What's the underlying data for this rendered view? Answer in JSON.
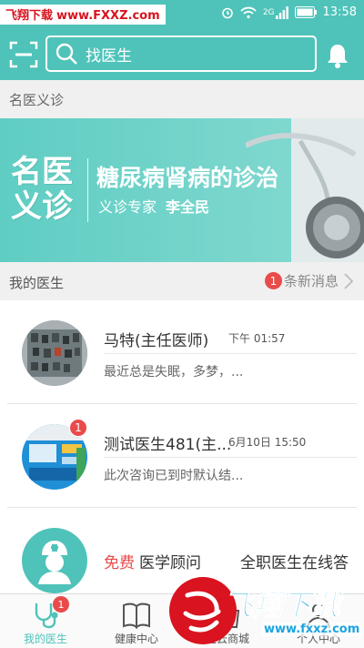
{
  "status_bar": {
    "watermark_left": "飞翔下载",
    "watermark_url": "www.FXXZ.com",
    "network": "2G",
    "time": "13:58"
  },
  "header": {
    "search_placeholder": "找医生",
    "icons": [
      "scan-icon",
      "search-icon",
      "bell-icon"
    ],
    "bg_color": "#4fc3b9"
  },
  "famous_section": {
    "title": "名医义诊",
    "banner": {
      "badge_line1": "名医",
      "badge_line2": "义诊",
      "title": "糖尿病肾病的诊治",
      "subtitle_label": "义诊专家",
      "doctor_name": "李全民"
    }
  },
  "my_doctors": {
    "title": "我的医生",
    "new_count": "1",
    "new_label": "条新消息",
    "items": [
      {
        "name": "马特(主任医师)",
        "time": "下午 01:57",
        "message": "最近总是失眠，多梦，...",
        "badge": ""
      },
      {
        "name": "测试医生481(主...",
        "time": "6月10日 15:50",
        "message": "此次咨询已到时默认结...",
        "badge": "1"
      }
    ],
    "advisor": {
      "free_label": "免费",
      "title": "医学顾问",
      "right_text": "全职医生在线答"
    }
  },
  "bottom_nav": {
    "tabs": [
      {
        "label": "我的医生",
        "icon": "stethoscope-icon",
        "active": true,
        "badge": "1"
      },
      {
        "label": "健康中心",
        "icon": "book-icon",
        "active": false,
        "badge": ""
      },
      {
        "label": "医云商城",
        "icon": "shop-icon",
        "active": false,
        "badge": ""
      },
      {
        "label": "个人中心",
        "icon": "person-icon",
        "active": false,
        "badge": ""
      }
    ]
  },
  "watermark": {
    "brand": "飞翔下载",
    "url": "www.fxxz.com"
  },
  "colors": {
    "accent": "#4fc3b9",
    "badge": "#e94b4b"
  }
}
